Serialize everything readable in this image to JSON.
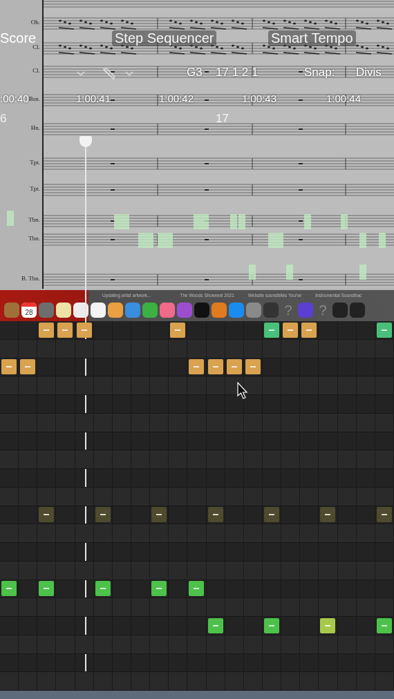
{
  "tabs": [
    {
      "label": "Score",
      "selected": true
    },
    {
      "label": "Step Sequencer",
      "selected": false
    },
    {
      "label": "Smart Tempo",
      "selected": false
    }
  ],
  "control_bar": {
    "pitch": "G3",
    "position": "17 1 2 1",
    "snap_label": "Snap:",
    "snap_value": "Divis"
  },
  "timeline": {
    "start": ":00:40",
    "ticks": [
      "1:00:41",
      "1:00:42",
      "1:00:43",
      "1:00:44"
    ]
  },
  "bars": [
    "6",
    "17"
  ],
  "score": {
    "staves": [
      {
        "label": "Ob.",
        "kind": "notes"
      },
      {
        "label": "Cl.",
        "kind": "notes"
      },
      {
        "label": "Cl.",
        "kind": "rest"
      },
      {
        "label": "Bsn.",
        "kind": "rest"
      },
      {
        "label": "Hn.",
        "kind": "rest"
      },
      {
        "label": "Tpt.",
        "kind": "rest"
      },
      {
        "label": "Tpt.",
        "kind": "rest"
      },
      {
        "label": "Tbn.",
        "kind": "rest"
      },
      {
        "label": "Tbn.",
        "kind": "rest"
      },
      {
        "label": "B. Tbn.",
        "kind": "rest"
      }
    ]
  },
  "dock": {
    "status": "Updating artist artwork...",
    "titles": [
      "The Woods Showreel 2021",
      "Website soundbites You've",
      "Instrumental Soundtrac"
    ],
    "items": [
      {
        "kind": "app",
        "color": "#a0703a"
      },
      {
        "kind": "calendar",
        "label": "28",
        "color": "#ffffff"
      },
      {
        "kind": "app",
        "color": "#6e6e6e"
      },
      {
        "kind": "app",
        "color": "#efe2a6"
      },
      {
        "kind": "app",
        "color": "#ececec"
      },
      {
        "kind": "app",
        "color": "#f4f4f4"
      },
      {
        "kind": "app",
        "color": "#e8a040"
      },
      {
        "kind": "app",
        "color": "#3a8ee0"
      },
      {
        "kind": "app",
        "color": "#3cb043"
      },
      {
        "kind": "app",
        "color": "#f06a8a"
      },
      {
        "kind": "app",
        "color": "#9b4fd0"
      },
      {
        "kind": "app",
        "color": "#111111"
      },
      {
        "kind": "app",
        "color": "#e07b20"
      },
      {
        "kind": "app",
        "color": "#1a8cf0"
      },
      {
        "kind": "app",
        "color": "#8a8a8a"
      },
      {
        "kind": "app",
        "color": "#333333"
      },
      {
        "kind": "unknown",
        "label": "?",
        "color": "#8a8a8a"
      },
      {
        "kind": "app",
        "color": "#5b3fd0"
      },
      {
        "kind": "unknown",
        "label": "?",
        "color": "#8a8a8a"
      },
      {
        "kind": "app",
        "color": "#222222"
      },
      {
        "kind": "app",
        "color": "#222222"
      }
    ]
  },
  "sequencer": {
    "rows": [
      {
        "steps": [
          {
            "on": false
          },
          {
            "on": false
          },
          {
            "on": true,
            "color": "#d9a24f"
          },
          {
            "on": true,
            "color": "#d9a24f"
          },
          {
            "on": true,
            "color": "#d9a24f"
          },
          {
            "on": false
          },
          {
            "on": false
          },
          {
            "on": false
          },
          {
            "on": false
          },
          {
            "on": true,
            "color": "#d9a24f"
          },
          {
            "on": false
          },
          {
            "on": false
          },
          {
            "on": false
          },
          {
            "on": false
          },
          {
            "on": true,
            "color": "#49c07a"
          },
          {
            "on": true,
            "color": "#d9a24f"
          },
          {
            "on": true,
            "color": "#d9a24f"
          },
          {
            "on": false
          },
          {
            "on": false
          },
          {
            "on": false
          },
          {
            "on": true,
            "color": "#49c07a"
          }
        ]
      },
      {},
      {
        "steps": [
          {
            "on": true,
            "color": "#d9a24f"
          },
          {
            "on": true,
            "color": "#d9a24f"
          },
          {
            "on": false
          },
          {
            "on": false
          },
          {
            "on": false
          },
          {
            "on": false
          },
          {
            "on": false
          },
          {
            "on": false
          },
          {
            "on": false
          },
          {
            "on": false
          },
          {
            "on": true,
            "color": "#d9a24f"
          },
          {
            "on": true,
            "color": "#d9a24f"
          },
          {
            "on": true,
            "color": "#d9a24f"
          },
          {
            "on": true,
            "color": "#d9a24f"
          },
          {
            "on": false
          },
          {
            "on": false
          },
          {
            "on": false
          },
          {
            "on": false
          },
          {
            "on": false
          },
          {
            "on": false
          },
          {
            "on": false
          }
        ]
      },
      {},
      {},
      {},
      {},
      {},
      {},
      {},
      {
        "steps": [
          {
            "on": false
          },
          {
            "on": false
          },
          {
            "on": true,
            "color": "#4f4b2e"
          },
          {
            "on": false
          },
          {
            "on": false
          },
          {
            "on": true,
            "color": "#4f4b2e"
          },
          {
            "on": false
          },
          {
            "on": false
          },
          {
            "on": true,
            "color": "#4f4b2e"
          },
          {
            "on": false
          },
          {
            "on": false
          },
          {
            "on": true,
            "color": "#4f4b2e"
          },
          {
            "on": false
          },
          {
            "on": false
          },
          {
            "on": true,
            "color": "#4f4b2e"
          },
          {
            "on": false
          },
          {
            "on": false
          },
          {
            "on": true,
            "color": "#4f4b2e"
          },
          {
            "on": false
          },
          {
            "on": false
          },
          {
            "on": true,
            "color": "#4f4b2e"
          }
        ]
      },
      {},
      {},
      {},
      {
        "steps": [
          {
            "on": true,
            "color": "#4cc24a"
          },
          {
            "on": false
          },
          {
            "on": true,
            "color": "#4cc24a"
          },
          {
            "on": false
          },
          {
            "on": false
          },
          {
            "on": true,
            "color": "#4cc24a"
          },
          {
            "on": false
          },
          {
            "on": false
          },
          {
            "on": true,
            "color": "#4cc24a"
          },
          {
            "on": false
          },
          {
            "on": true,
            "color": "#4cc24a"
          },
          {
            "on": false
          },
          {
            "on": false
          },
          {
            "on": false
          },
          {
            "on": false
          },
          {
            "on": false
          },
          {
            "on": false
          },
          {
            "on": false
          },
          {
            "on": false
          },
          {
            "on": false
          },
          {
            "on": false
          }
        ]
      },
      {},
      {
        "steps": [
          {
            "on": false
          },
          {
            "on": false
          },
          {
            "on": false
          },
          {
            "on": false
          },
          {
            "on": false
          },
          {
            "on": false
          },
          {
            "on": false
          },
          {
            "on": false
          },
          {
            "on": false
          },
          {
            "on": false
          },
          {
            "on": false
          },
          {
            "on": true,
            "color": "#4cc24a"
          },
          {
            "on": false
          },
          {
            "on": false
          },
          {
            "on": true,
            "color": "#4cc24a"
          },
          {
            "on": false
          },
          {
            "on": false
          },
          {
            "on": true,
            "color": "#a7c94a"
          },
          {
            "on": false
          },
          {
            "on": false
          },
          {
            "on": true,
            "color": "#4cc24a"
          }
        ]
      },
      {},
      {},
      {}
    ]
  }
}
